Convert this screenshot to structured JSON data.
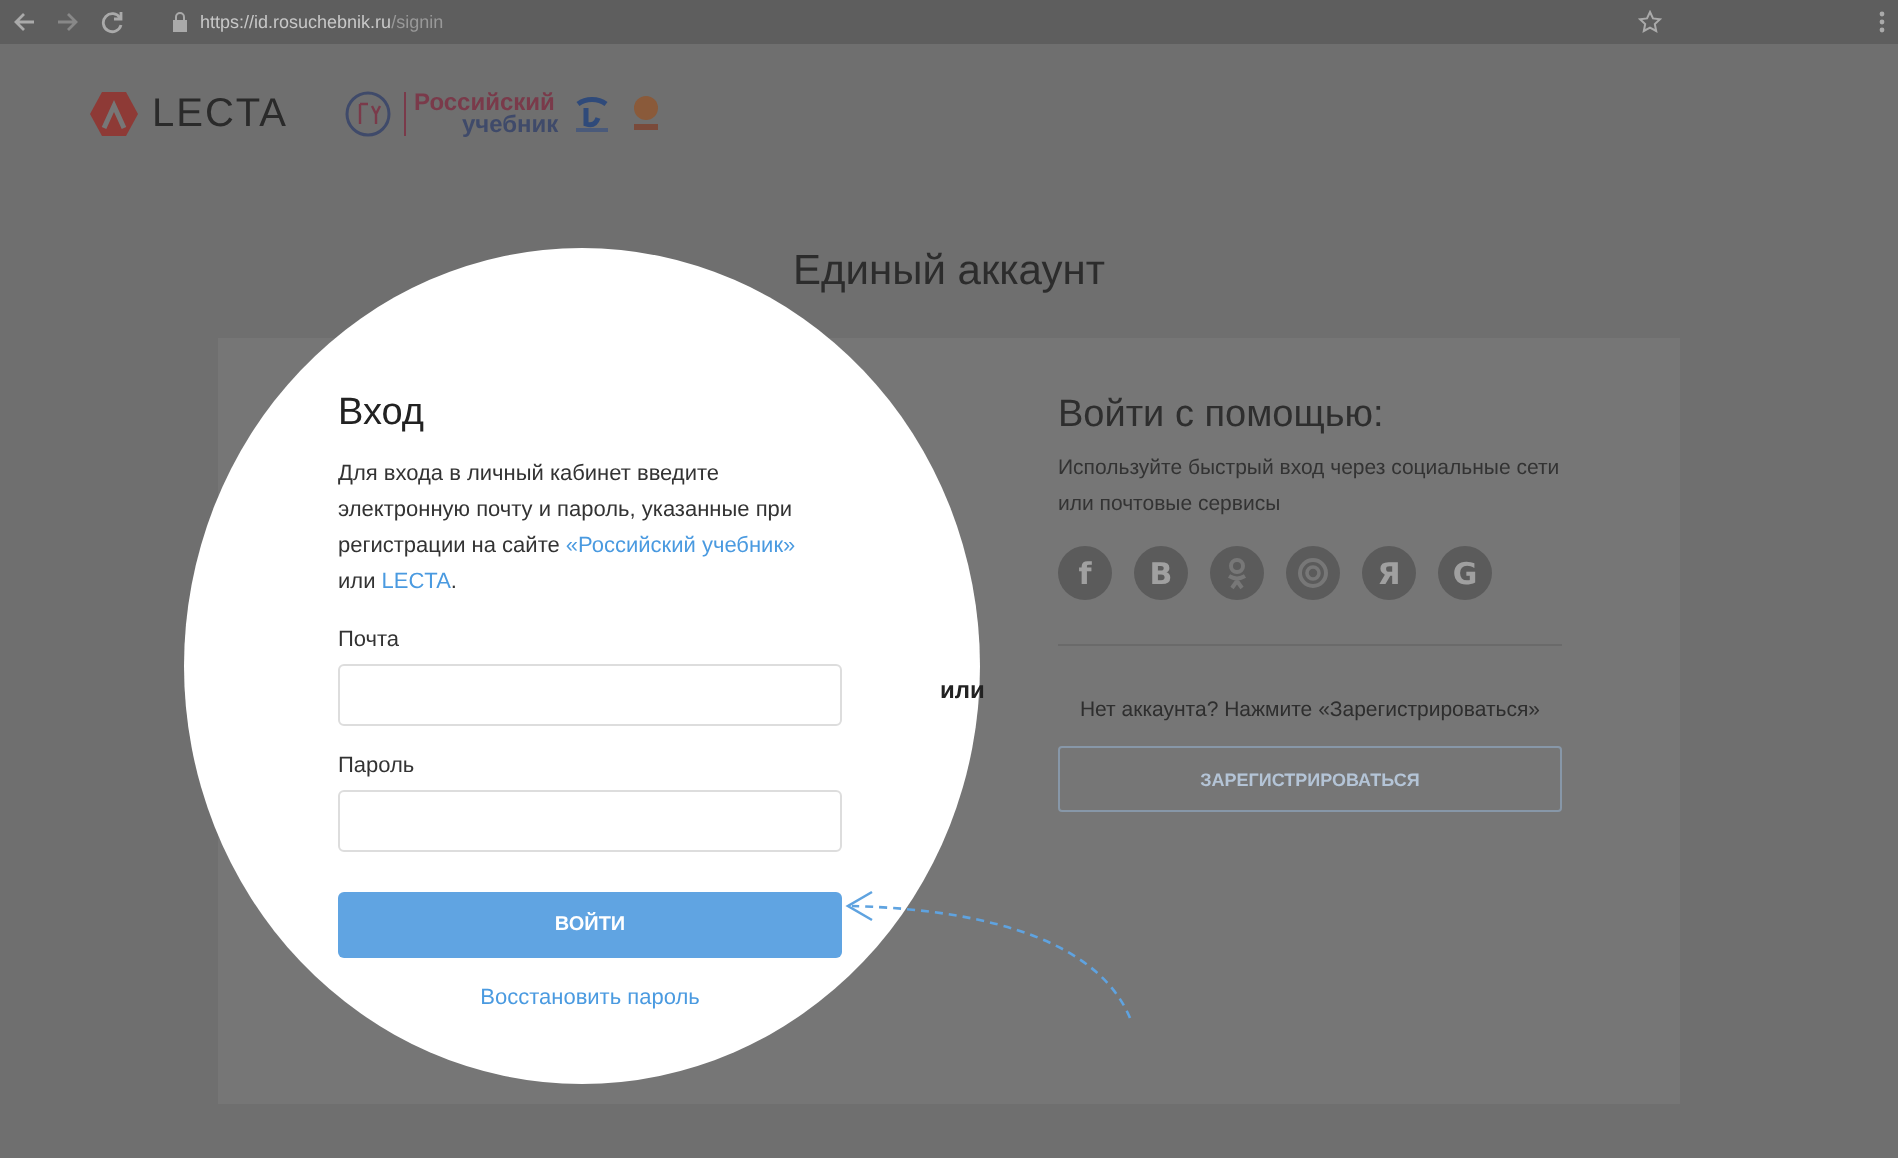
{
  "browser": {
    "url_host": "https://id.rosuchebnik.ru",
    "url_path": "/signin"
  },
  "header": {
    "lecta": "LECTA",
    "rosuchebnik": [
      "Российский",
      "учебник"
    ]
  },
  "page_title": "Единый аккаунт",
  "login": {
    "title": "Вход",
    "description": [
      {
        "kind": "text",
        "text": "Для входа в личный кабинет введите электронную почту и пароль, указанные при регистрации на сайте "
      },
      {
        "kind": "link",
        "text": "«Российский учебник»"
      },
      {
        "kind": "text",
        "text": " или "
      },
      {
        "kind": "link",
        "text": "LECTA"
      },
      {
        "kind": "text",
        "text": "."
      }
    ],
    "fields": [
      {
        "label": "Почта"
      },
      {
        "label": "Пароль"
      }
    ],
    "button": "ВОЙТИ",
    "restore_link": "Восстановить пароль"
  },
  "separator": "или",
  "social": {
    "title": "Войти с помощью:",
    "description": "Используйте быстрый вход через социальные сети или почтовые сервисы",
    "providers": [
      {
        "kind": "letter",
        "glyph": "f"
      },
      {
        "kind": "letter",
        "glyph": "B"
      },
      {
        "kind": "ok"
      },
      {
        "kind": "ring"
      },
      {
        "kind": "letter",
        "glyph": "Я"
      },
      {
        "kind": "letter",
        "glyph": "G"
      }
    ]
  },
  "register": {
    "text": "Нет аккаунта? Нажмите «Зарегистрироваться»",
    "button": "ЗАРЕГИСТРИРОВАТЬСЯ"
  }
}
